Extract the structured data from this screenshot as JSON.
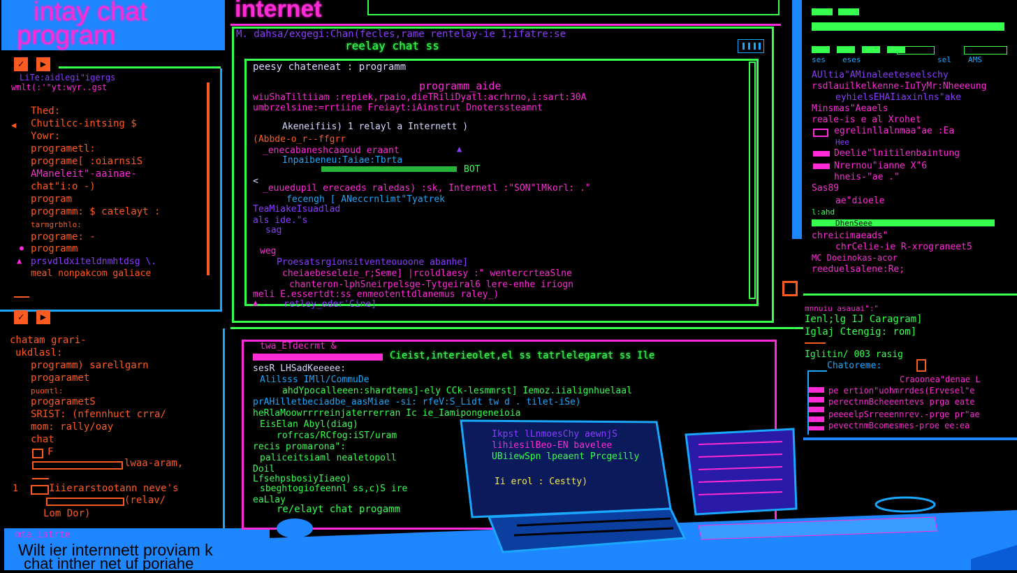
{
  "colors": {
    "pink": "#ff2bd6",
    "orange": "#ff5a1f",
    "green": "#36ff4f",
    "blue": "#1aa7ff",
    "purple": "#8a3cff",
    "yellow": "#f4e84a"
  },
  "title_badge": {
    "line1": "intay chat",
    "line2": "program"
  },
  "header": {
    "title": "internet"
  },
  "top_bar": {
    "path": "M. dahsa/exgegi:Chan(fecles,rame rentelay-ie 1;ifatre:se",
    "subtitle": "reelay chat ss",
    "icon": "bars-icon"
  },
  "terminal": {
    "heading": "peesy chateneat  :  programm",
    "lines": [
      "programm_aide",
      "wiuShaTiltiiam :repiek,rpaio,dieTRiliDyatl:acrhrno,i:sart:30A",
      "umbrzelsine:=rrtiine Freiayt:iAinstrut Dnoterssteamnt",
      "Akeneifiis) 1 relayl a  Internett )",
      "(Abbde-o_r--ffgrr",
      "_enecabaneshcaaoud  eraant",
      "Inpaibeneu:Taiae:Tbrta",
      "BOT",
      "<",
      "_euuedupil erecaeds raledas) :sk, Internetl :\"SON\"lMkorl: .\"",
      "fecengh [ ANeccrnlimt\"Tyatrek",
      "TeaMiakeIsuadlad",
      "als ide.\"s",
      "sag",
      "weg",
      "Proesatsrgionsitventeouoone abanhe]",
      "cheiaebeseleie_r;Seme]  |rcoldlaesy :\"  wentercrteaSlne",
      "chanteron-lphSneirpelsge-Tytgeiral6 lere-enhe iriogn",
      "meli                              E.essertdt:ss enmeotenttdlanemus raley_)",
      "retley_oder'Cine]"
    ]
  },
  "left_upper": {
    "header": "LiTe:aidlegi\"igergs",
    "sub": "wmlt(:'\"yt:wyr..gst",
    "items": [
      "Thed:",
      "Chutilcc-intsing $",
      "Yowr:",
      "programetl:",
      "programe[ :oiarnsiS",
      "AManeleit\"-aainae-",
      "chat\"i:o  -)",
      "program",
      "programm: $ catelayt :",
      "tarmgrbhlo:",
      "programe:    -",
      "programm",
      "prsvdldxiteldnmhtdsg \\.",
      "meal nonpakcom galiace"
    ]
  },
  "left_lower": {
    "items": [
      "chatam grari-",
      "ukdlasl:",
      "programm) sarellgarn",
      "progaramet",
      "puomtl:",
      "progarametS",
      "SRIST: (nfennhuct crra/",
      "mom: rally/oay",
      "chat",
      "F",
      "lwaa-aram,",
      "Iiierarstootann neve's",
      "(relav/",
      "Lom Dor)"
    ]
  },
  "bottom_caption": {
    "header": "mta_istrte",
    "line1": "Wilt ier internnett proviam k",
    "line2": "chat  inther net uf poriahe"
  },
  "bottom_terminal": {
    "header": "twa_ETdecrmt &",
    "title": "Cieist,interieolet,el ss  tatrlelegarat  ss Ile",
    "lines": [
      "sesR LHSadKeeeee:",
      "Alilsss IMll/CommuDe",
      "ahdYpocalleeen:shardtems]-ely CCk-lesmmrst] Iemoz.iialignhuelaal",
      "prAHilletbeciadbe_aasMiae -si: rfeV:S_Lidt  tw  d  . tilet-iSe)",
      "heRlaMoowrrrreinjaterrerran  Ic   ie_Iamipongeneioia",
      "EisElan Abyl(diag)",
      "rofrcas/RCfog:iST/uram",
      "recis  promarona\":",
      "paliceitsiaml nealetopoll",
      "Doil",
      "LfsehpsbosiyIiaeo)",
      "sbeghtogiofeennl ss,c)S  ire",
      "eaLlay",
      "re/elayt  chat  progamm"
    ]
  },
  "laptop": {
    "lines": [
      "Ikpst lLnmoesChy aewnjS",
      "lihiesilBeo-EN bavelee",
      "UBiiewSpn lpeaent Prcgeilly",
      "Ii  erol  :  Cestty)"
    ]
  },
  "right_upper": {
    "tags": [
      "ses",
      "eses",
      "sel",
      "AMS"
    ],
    "lines": [
      "AUltia\"AMinaleeteseelschy",
      "rsdlauilkelkenne-IuTyMr:Nheeeung",
      "eyhielsEHAIiaxinlns\"ake",
      "Minsmas\"Aeaels",
      "reale-is e al Xrohet",
      "egrelinllalnmaa\"ae  :Ea",
      "Hee",
      "Deelie\"lnitilenbaintung",
      "Nrernou\"ianne X\"6",
      "hneis-\"ae  .\"",
      "Sas89",
      "ae\"dioele",
      "l:ahd",
      "DhenSeee",
      "chreicimaeads\"",
      "chrCelie-ie R-xrograneet5",
      "MC Doeinokas-acor",
      "reeduelsalene:Re;"
    ]
  },
  "right_lower": {
    "header": "mnnuiu asauai\":\"",
    "lines": [
      "Ienl;lg  IJ  Caragram]",
      "Iglaj  Ctengig:  rom]",
      "Iglitin/ 003  rasig",
      "Chatoreme:",
      "Craoonea\"denae L",
      "pe ertion\"uohmrrdes(Ervesel\"e",
      "perectnnBcheeentevs prga eate",
      "peeeelpSrreeennrev.-prge pr\"ae",
      "pevectnmBcomesmes-proe ee:ea"
    ]
  },
  "icons": {
    "play": "play-icon",
    "check": "check-icon",
    "pointer": "pointer-icon"
  }
}
